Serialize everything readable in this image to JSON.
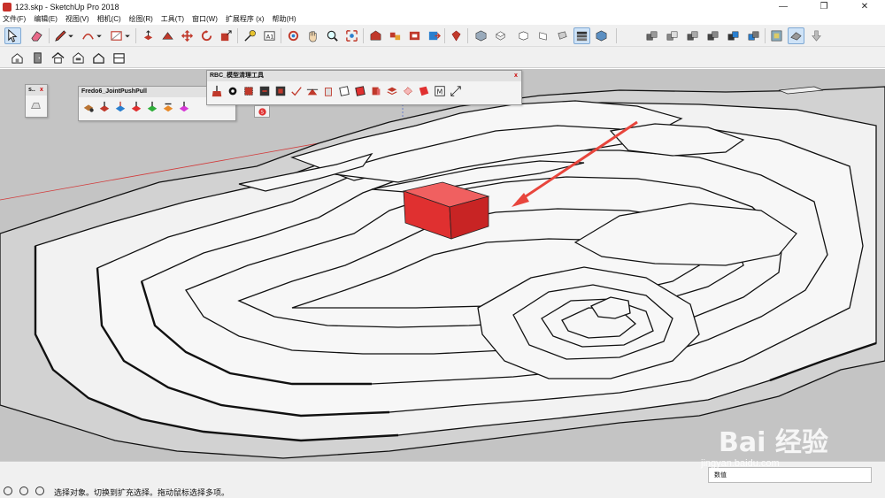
{
  "window": {
    "title": "123.skp - SketchUp Pro 2018",
    "minimize": "—",
    "maximize": "❐",
    "close": "✕"
  },
  "menu": [
    "文件(F)",
    "编辑(E)",
    "视图(V)",
    "相机(C)",
    "绘图(R)",
    "工具(T)",
    "窗口(W)",
    "扩展程序 (x)",
    "帮助(H)"
  ],
  "panels": {
    "small": {
      "title": "s..",
      "close": "x"
    },
    "fredo": {
      "title": "Fredo6_JointPushPull",
      "close": "x"
    },
    "rbc": {
      "title": "RBC_模型清理工具",
      "close": "x"
    }
  },
  "status": {
    "text": "选择对象。切换到扩充选择。拖动鼠标选择多项。",
    "measurement_label": "数值"
  },
  "watermark": {
    "brand": "Bai  经验",
    "url": "jingyan.baidu.com"
  },
  "colors": {
    "viewport_bg": "#c4c4c4",
    "terrain_fill": "#f7f7f7",
    "box_red": "#e03030",
    "arrow_red": "#e8453c",
    "axis_green": "#2f9e3a",
    "axis_red": "#d23a3a"
  }
}
